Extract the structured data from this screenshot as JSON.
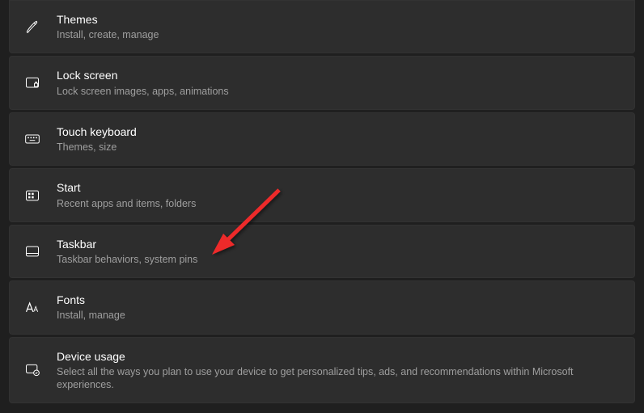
{
  "items": [
    {
      "id": "themes",
      "title": "Themes",
      "subtitle": "Install, create, manage"
    },
    {
      "id": "lock-screen",
      "title": "Lock screen",
      "subtitle": "Lock screen images, apps, animations"
    },
    {
      "id": "touch-keyboard",
      "title": "Touch keyboard",
      "subtitle": "Themes, size"
    },
    {
      "id": "start",
      "title": "Start",
      "subtitle": "Recent apps and items, folders"
    },
    {
      "id": "taskbar",
      "title": "Taskbar",
      "subtitle": "Taskbar behaviors, system pins"
    },
    {
      "id": "fonts",
      "title": "Fonts",
      "subtitle": "Install, manage"
    },
    {
      "id": "device-usage",
      "title": "Device usage",
      "subtitle": "Select all the ways you plan to use your device to get personalized tips, ads, and recommendations within Microsoft experiences."
    }
  ],
  "annotation": {
    "target": "taskbar"
  }
}
